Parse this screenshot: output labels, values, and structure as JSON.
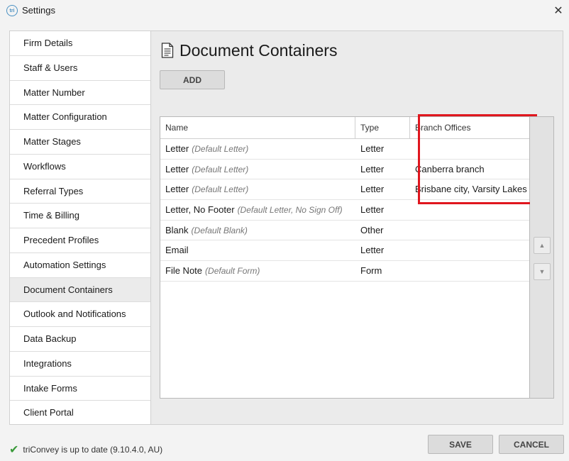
{
  "window": {
    "title": "Settings",
    "app_icon_text": "tri"
  },
  "sidebar": {
    "items": [
      {
        "label": "Firm Details"
      },
      {
        "label": "Staff & Users"
      },
      {
        "label": "Matter Number"
      },
      {
        "label": "Matter Configuration"
      },
      {
        "label": "Matter Stages"
      },
      {
        "label": "Workflows"
      },
      {
        "label": "Referral Types"
      },
      {
        "label": "Time & Billing"
      },
      {
        "label": "Precedent Profiles"
      },
      {
        "label": "Automation Settings"
      },
      {
        "label": "Document Containers"
      },
      {
        "label": "Outlook and Notifications"
      },
      {
        "label": "Data Backup"
      },
      {
        "label": "Integrations"
      },
      {
        "label": "Intake Forms"
      },
      {
        "label": "Client Portal"
      }
    ],
    "active": "Document Containers"
  },
  "main": {
    "title": "Document Containers",
    "title_icon": "document-icon",
    "add_label": "ADD",
    "table": {
      "columns": [
        "Name",
        "Type",
        "Branch Offices"
      ],
      "rows": [
        {
          "name": "Letter",
          "default": "(Default Letter)",
          "type": "Letter",
          "branch": ""
        },
        {
          "name": "Letter",
          "default": "(Default Letter)",
          "type": "Letter",
          "branch": "Canberra branch"
        },
        {
          "name": "Letter",
          "default": "(Default Letter)",
          "type": "Letter",
          "branch": "Brisbane city, Varsity Lakes"
        },
        {
          "name": "Letter, No Footer",
          "default": "(Default Letter, No Sign Off)",
          "type": "Letter",
          "branch": ""
        },
        {
          "name": "Blank",
          "default": "(Default Blank)",
          "type": "Other",
          "branch": ""
        },
        {
          "name": "Email",
          "default": "",
          "type": "Letter",
          "branch": ""
        },
        {
          "name": "File Note",
          "default": "(Default Form)",
          "type": "Form",
          "branch": ""
        }
      ]
    },
    "highlight_color": "#e0161e"
  },
  "status": {
    "text": "triConvey is up to date (9.10.4.0, AU)",
    "icon": "check-icon"
  },
  "footer": {
    "save_label": "SAVE",
    "cancel_label": "CANCEL"
  }
}
